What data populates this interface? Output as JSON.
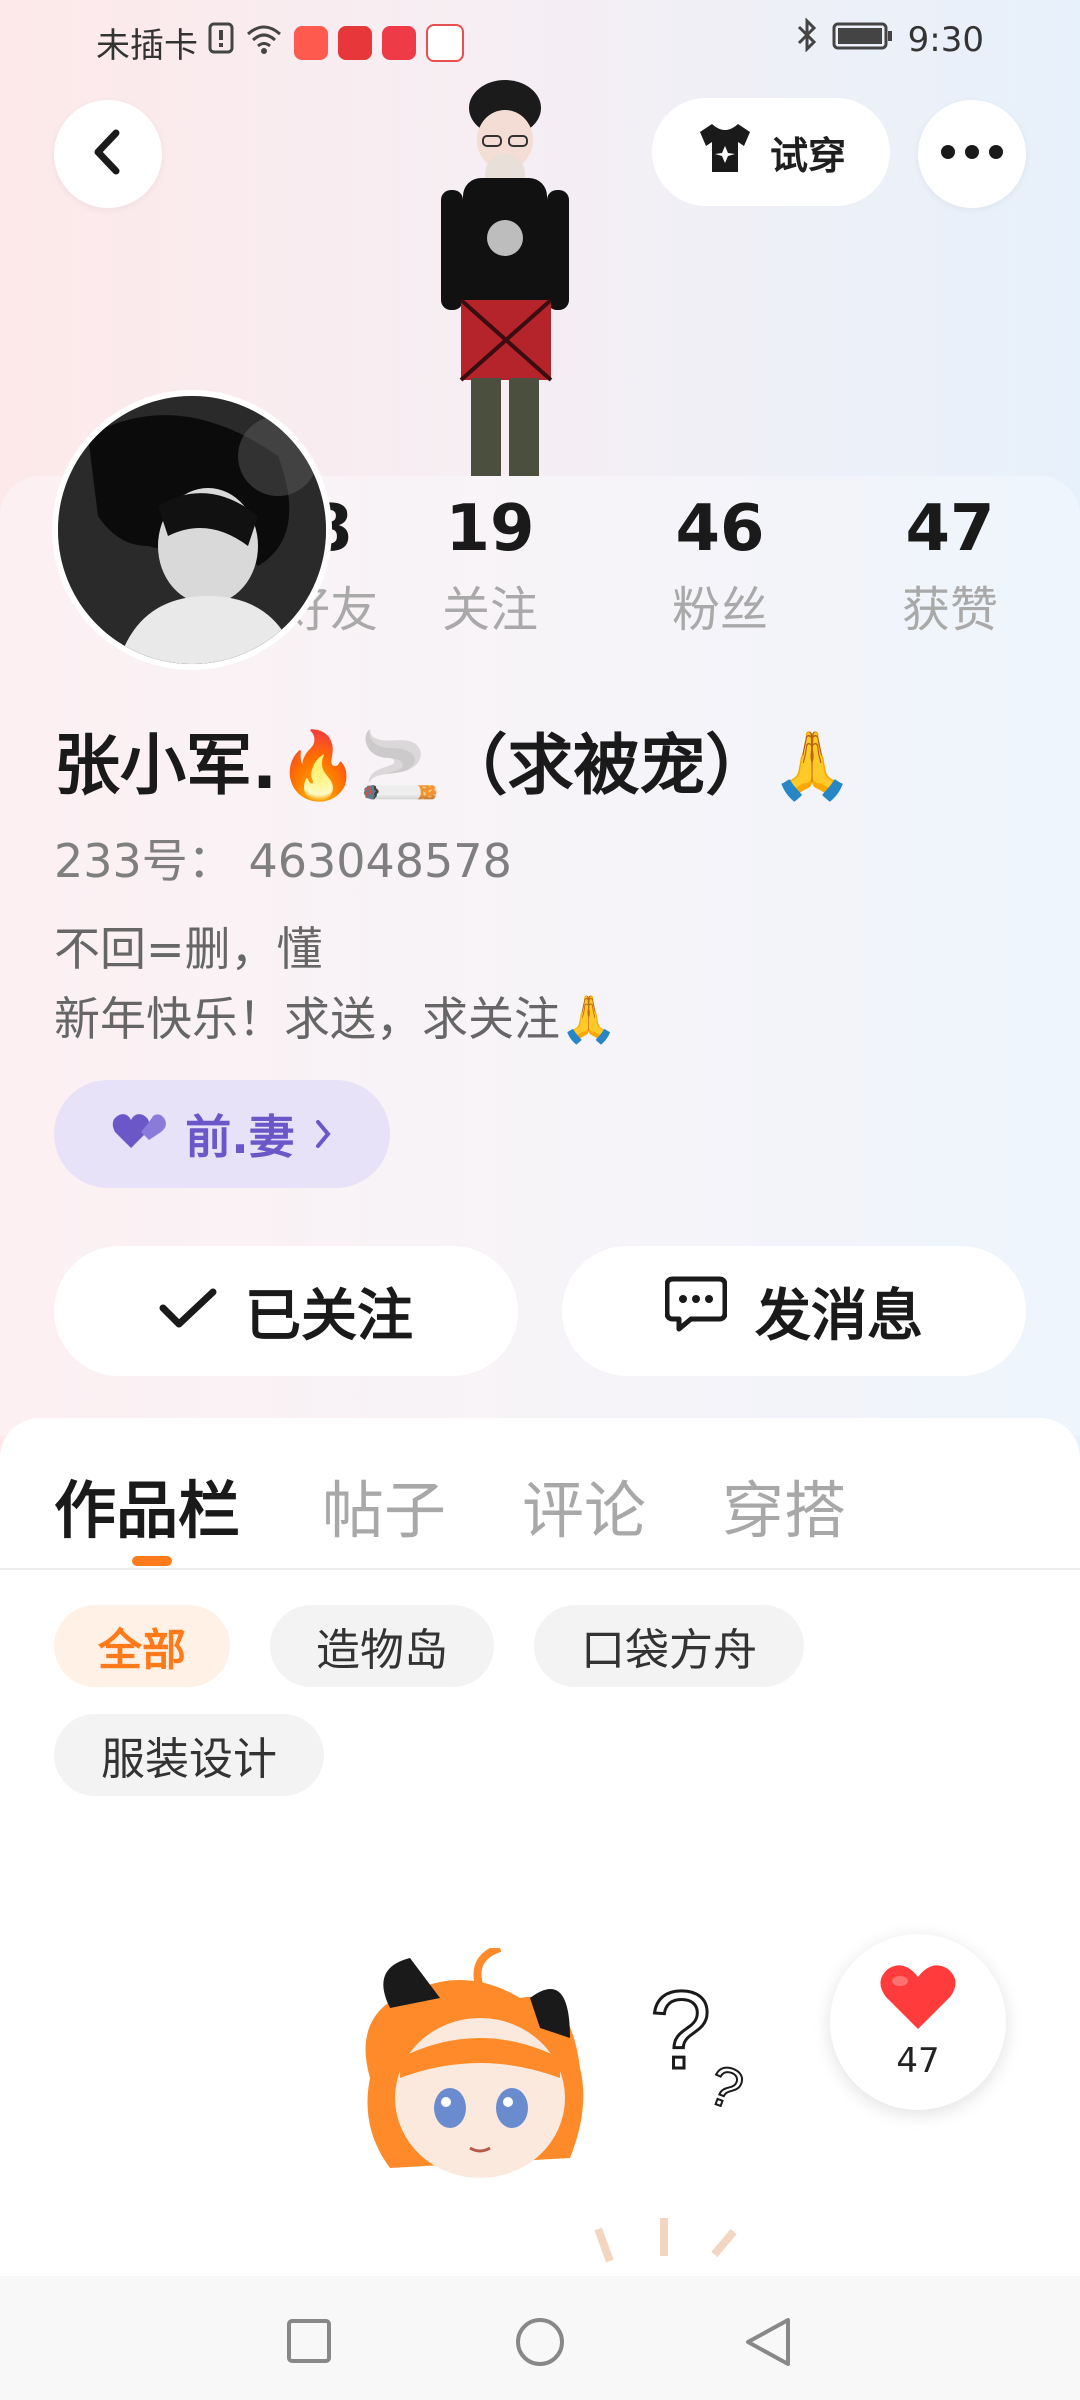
{
  "status_bar": {
    "carrier": "未插卡",
    "time": "9:30"
  },
  "header": {
    "try_on_label": "试穿"
  },
  "profile": {
    "name": "张小军.🔥🚬（求被宠）🙏",
    "id_label": "233号：",
    "id_value": "463048578",
    "bio_lines": [
      "不回=删，懂",
      "新年快乐！求送，求关注🙏"
    ],
    "tag_label": "前.妻"
  },
  "stats": [
    {
      "num": "8",
      "label": "好友"
    },
    {
      "num": "19",
      "label": "关注"
    },
    {
      "num": "46",
      "label": "粉丝"
    },
    {
      "num": "47",
      "label": "获赞"
    }
  ],
  "actions": {
    "following_label": "已关注",
    "message_label": "发消息"
  },
  "tabs": [
    "作品栏",
    "帖子",
    "评论",
    "穿搭"
  ],
  "filters": [
    "全部",
    "造物岛",
    "口袋方舟",
    "服装设计"
  ],
  "like_float": {
    "count": "47"
  },
  "colors": {
    "accent": "#ff7a1a",
    "tag_purple": "#6b57c8",
    "heart": "#ff3b3b"
  },
  "icons": {
    "back": "chevron-left-icon",
    "tshirt": "tshirt-icon",
    "more": "more-dots-icon",
    "check": "check-icon",
    "message": "chat-bubble-icon",
    "heart": "heart-icon"
  }
}
